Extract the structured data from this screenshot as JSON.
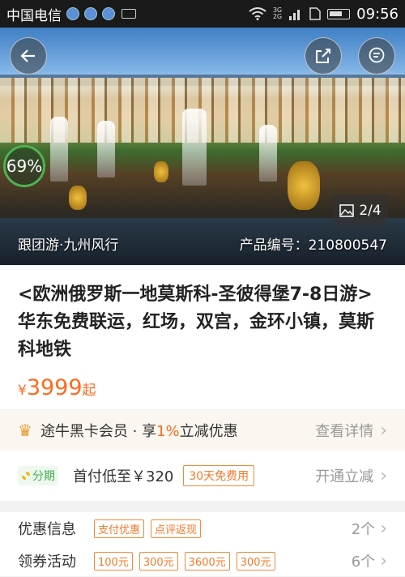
{
  "status_bar": {
    "carrier": "中国电信",
    "net_top": "3G",
    "net_bottom": "2G",
    "time": "09:56"
  },
  "hero": {
    "discount_badge": "69%",
    "image_counter": "2/4",
    "caption": "跟团游·九州风行",
    "product_code": "产品编号：210800547"
  },
  "product": {
    "title": "<欧洲俄罗斯一地莫斯科-圣彼得堡7-8日游>华东免费联运，红场，双宫，金环小镇，莫斯科地铁",
    "price_symbol": "¥",
    "price": "3999",
    "price_suffix": "起"
  },
  "vip": {
    "text_pre": "途牛黑卡会员 · 享",
    "highlight": "1%",
    "text_post": "立减优惠",
    "link": "查看详情"
  },
  "installment": {
    "badge": "分期",
    "text": "首付低至￥320",
    "tag": "30天免费用",
    "link": "开通立减"
  },
  "promotions": [
    {
      "label": "优惠信息",
      "tags": [
        "支付优惠",
        "点评返现"
      ],
      "count": "2个"
    },
    {
      "label": "领券活动",
      "tags": [
        "100元",
        "300元",
        "3600元",
        "300元"
      ],
      "count": "6个"
    }
  ],
  "colors": {
    "accent": "#ff6a1f",
    "green": "#3fae4a"
  }
}
